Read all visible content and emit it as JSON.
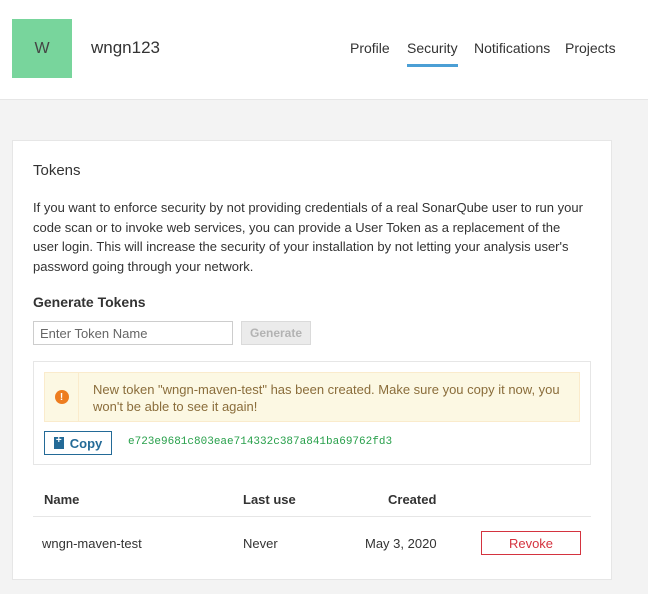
{
  "header": {
    "avatar_letter": "W",
    "username": "wngn123",
    "nav": [
      {
        "label": "Profile"
      },
      {
        "label": "Security",
        "active": true
      },
      {
        "label": "Notifications"
      },
      {
        "label": "Projects"
      }
    ]
  },
  "tokens": {
    "title": "Tokens",
    "description": "If you want to enforce security by not providing credentials of a real SonarQube user to run your code scan or to invoke web services, you can provide a User Token as a replacement of the user login. This will increase the security of your installation by not letting your analysis user's password going through your network.",
    "generate_title": "Generate Tokens",
    "input_placeholder": "Enter Token Name",
    "input_value": "",
    "generate_label": "Generate",
    "alert_message": "New token \"wngn-maven-test\" has been created. Make sure you copy it now, you won't be able to see it again!",
    "copy_label": "Copy",
    "token_value": "e723e9681c803eae714332c387a841ba69762fd3",
    "table": {
      "headers": {
        "name": "Name",
        "last_use": "Last use",
        "created": "Created"
      },
      "rows": [
        {
          "name": "wngn-maven-test",
          "last_use": "Never",
          "created": "May 3, 2020",
          "action": "Revoke"
        }
      ]
    }
  },
  "colors": {
    "avatar": "#78d59c",
    "nav_active": "#4b9fd5",
    "alert_icon": "#ed7d20",
    "copy_button": "#236a97",
    "token_text": "#28a04b",
    "revoke": "#d4333f"
  },
  "icons": {
    "alert": "warning-circle-icon",
    "copy": "clipboard-icon"
  }
}
